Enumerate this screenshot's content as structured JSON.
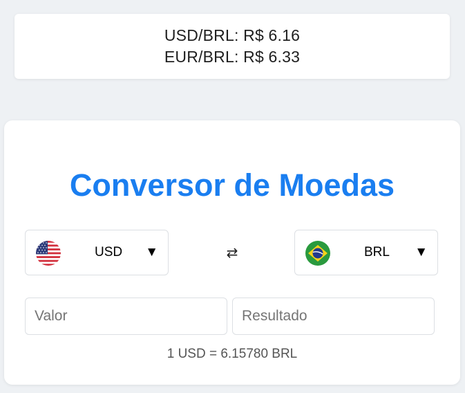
{
  "rates": {
    "usd_brl": "USD/BRL: R$ 6.16",
    "eur_brl": "EUR/BRL: R$ 6.33"
  },
  "converter": {
    "title": "Conversor de Moedas",
    "from": {
      "code": "USD",
      "flag_icon": "us-flag-icon",
      "caret": "▼"
    },
    "to": {
      "code": "BRL",
      "flag_icon": "brazil-flag-icon",
      "caret": "▼"
    },
    "swap_symbol": "⇄",
    "value_input": {
      "placeholder": "Valor",
      "value": ""
    },
    "result_input": {
      "placeholder": "Resultado",
      "value": ""
    },
    "rate_info": "1 USD = 6.15780 BRL"
  },
  "colors": {
    "background": "#eef1f4",
    "title": "#1a7ef0",
    "card": "#ffffff"
  }
}
